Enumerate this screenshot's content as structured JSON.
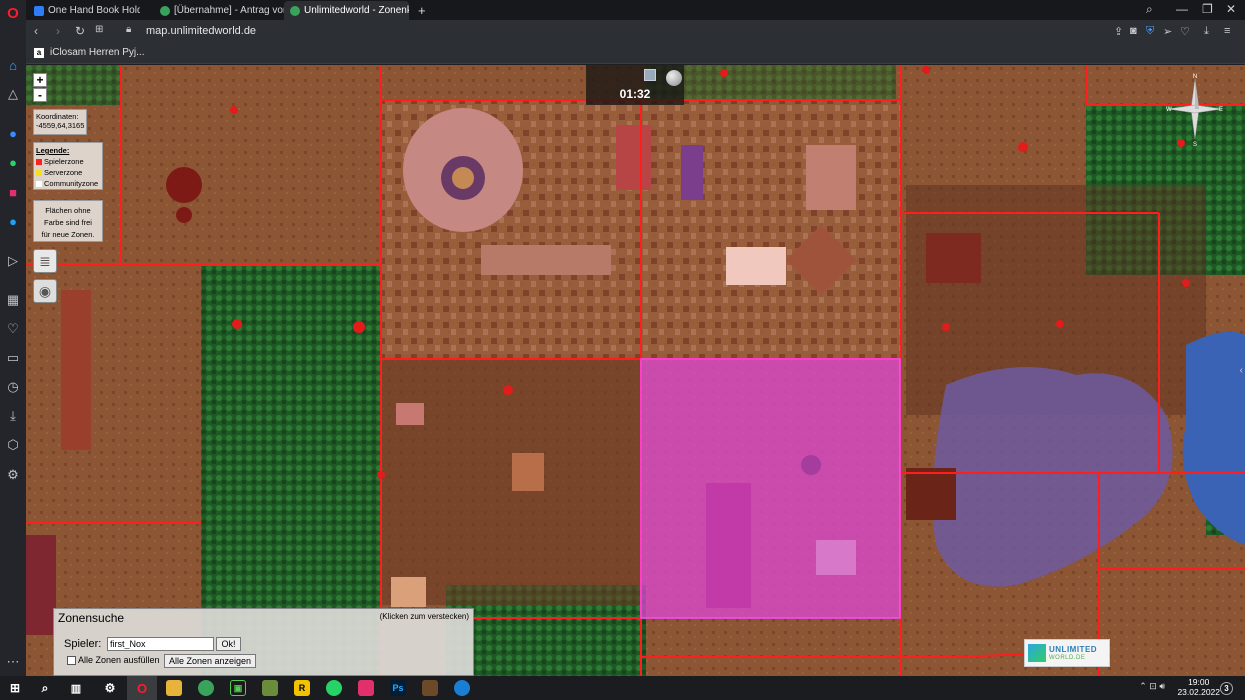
{
  "browser": {
    "tabs": [
      {
        "label": "One Hand Book Holder cr",
        "color": "#2f7df6"
      },
      {
        "label": "[Übernahme] - Antrag von",
        "color": "#3aa35b"
      },
      {
        "label": "Unlimitedworld - Zonenka",
        "color": "#3aa35b"
      }
    ],
    "new_tab": "+",
    "url": "map.unlimitedworld.de",
    "bookmark": "iClosam Herren Pyj..."
  },
  "map": {
    "zoom_in": "+",
    "zoom_out": "-",
    "coords_label": "Koordinaten:",
    "coords_value": "-4559,64,3165",
    "legend": {
      "title": "Legende:",
      "items": [
        {
          "label": "Spielerzone",
          "color": "#ff2020"
        },
        {
          "label": "Serverzone",
          "color": "#f2e11b"
        },
        {
          "label": "Communityzone",
          "color": "#ffffff"
        }
      ]
    },
    "free_note_1": "Flächen ohne",
    "free_note_2": "Farbe sind frei",
    "free_note_3": "für neue Zonen.",
    "clock": "01:32",
    "compass": {
      "n": "N",
      "s": "S",
      "w": "W",
      "e": "E"
    },
    "zone_search": {
      "title": "Zonensuche",
      "hide_hint": "(Klicken zum verstecken)",
      "player_label": "Spieler:",
      "player_value": "first_Nox",
      "ok": "Ok!",
      "fill_label": "Alle Zonen ausfüllen",
      "show_all": "Alle Zonen anzeigen"
    },
    "logo": {
      "line1": "UNLIMITED",
      "line2": "WORLD.DE"
    }
  },
  "taskbar": {
    "time": "19:00",
    "date": "23.02.2022",
    "notif": "3"
  }
}
